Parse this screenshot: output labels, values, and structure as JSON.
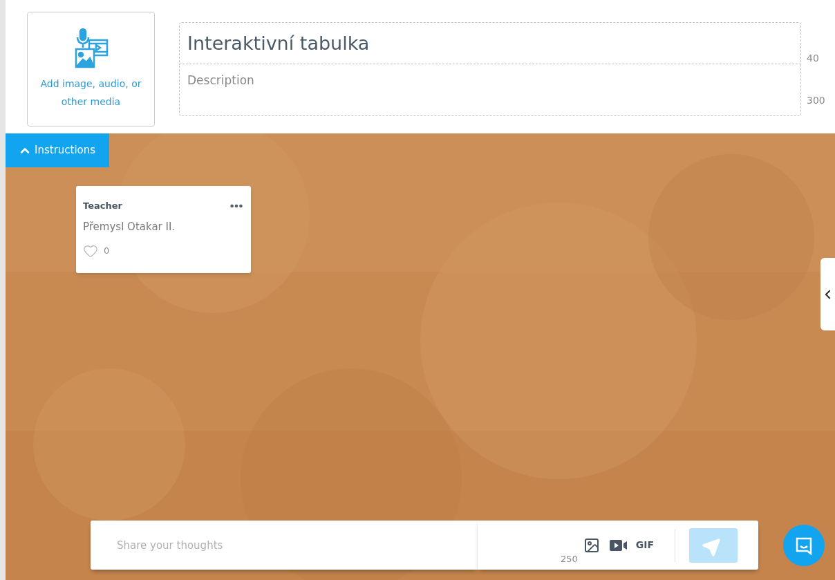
{
  "media_button": {
    "label": "Add image, audio, or other media"
  },
  "title_field": {
    "value": "Interaktivní tabulka",
    "counter": "40"
  },
  "description_field": {
    "placeholder": "Description",
    "counter": "300"
  },
  "instructions_button": {
    "label": "Instructions",
    "expanded": true
  },
  "posts": [
    {
      "author": "Teacher",
      "text": "Přemysl Otakar II.",
      "likes": "0",
      "liked": false
    }
  ],
  "composer": {
    "placeholder": "Share your thoughts",
    "counter": "250",
    "gif_label": "GIF",
    "send_enabled": false
  }
}
